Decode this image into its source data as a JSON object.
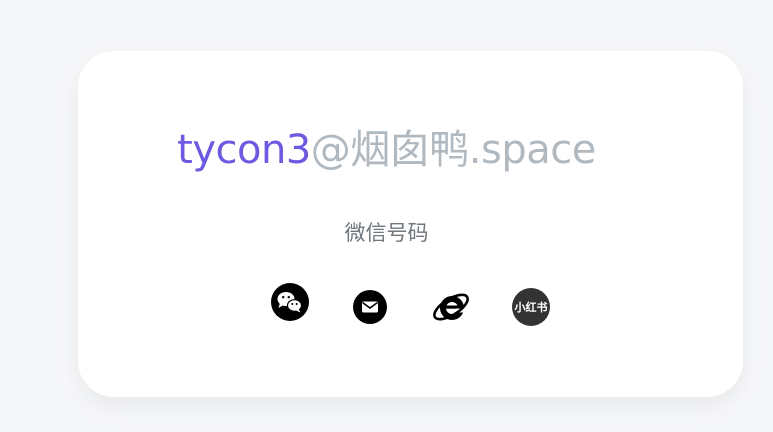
{
  "profile": {
    "name": "tycon3",
    "domain": "@烟囱鸭.space",
    "subtitle": "微信号码"
  },
  "links": [
    {
      "icon": "wechat-icon"
    },
    {
      "icon": "email-icon"
    },
    {
      "icon": "browser-icon"
    },
    {
      "icon": "xiaohongshu-icon",
      "label": "小红书"
    }
  ],
  "colors": {
    "accent": "#6c5ae0",
    "muted": "#b1b9c0",
    "subtitle": "#6f767c",
    "background": "#f6f7f9",
    "card": "#ffffff",
    "icon": "#000000"
  }
}
